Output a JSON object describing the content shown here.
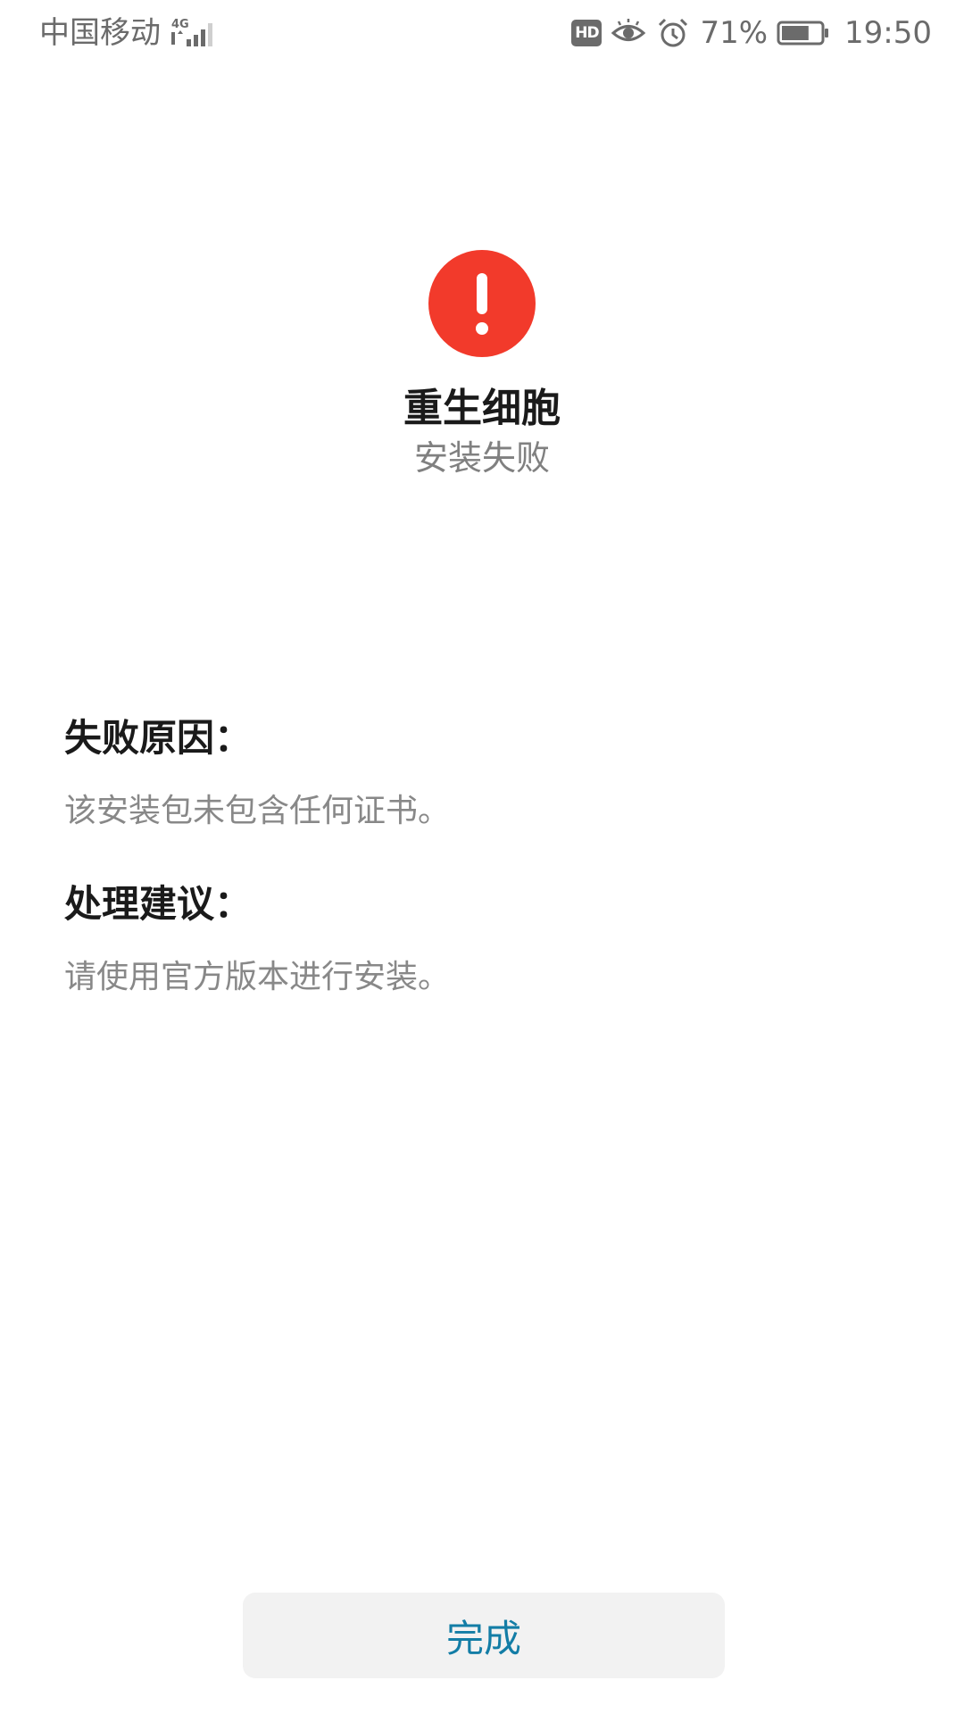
{
  "status_bar": {
    "carrier": "中国移动",
    "network_type": "4G",
    "hd_badge": "HD",
    "eye_icon": "eye-comfort-icon",
    "alarm_icon": "alarm-clock-icon",
    "battery_percent": "71%",
    "battery_level": 0.71,
    "time": "19:50"
  },
  "app": {
    "icon": "exclamation-alert-icon",
    "alert_color": "#f23a2b",
    "name": "重生细胞",
    "status": "安装失败"
  },
  "failure": {
    "reason_title": "失败原因：",
    "reason_text": "该安装包未包含任何证书。",
    "suggestion_title": "处理建议：",
    "suggestion_text": "请使用官方版本进行安装。"
  },
  "actions": {
    "done_label": "完成",
    "done_color": "#137da6"
  }
}
